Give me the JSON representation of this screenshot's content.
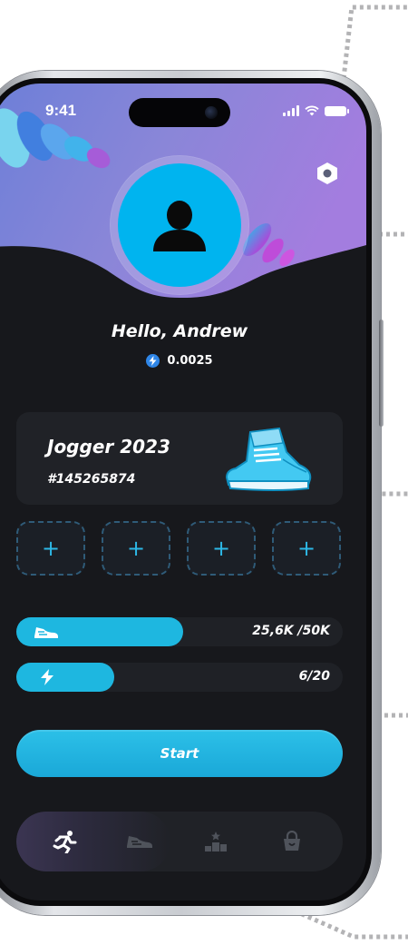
{
  "status_bar": {
    "time": "9:41"
  },
  "profile": {
    "greeting": "Hello, Andrew",
    "balance": "0.0025"
  },
  "sneaker": {
    "name": "Jogger 2023",
    "id": "#145265874"
  },
  "slots": [
    "+",
    "+",
    "+",
    "+"
  ],
  "stats": {
    "steps": {
      "value": "25,6K /50K",
      "progress": 0.512
    },
    "energy": {
      "value": "6/20",
      "progress": 0.3
    }
  },
  "start_button": {
    "label": "Start"
  },
  "nav": {
    "items": [
      "run-icon",
      "sneaker-icon",
      "leaderboard-icon",
      "shop-bag-icon"
    ],
    "active": "run-icon"
  },
  "colors": {
    "accent": "#1eb7e0",
    "avatar": "#00b4ef",
    "background": "#17181c",
    "card": "#202227"
  }
}
